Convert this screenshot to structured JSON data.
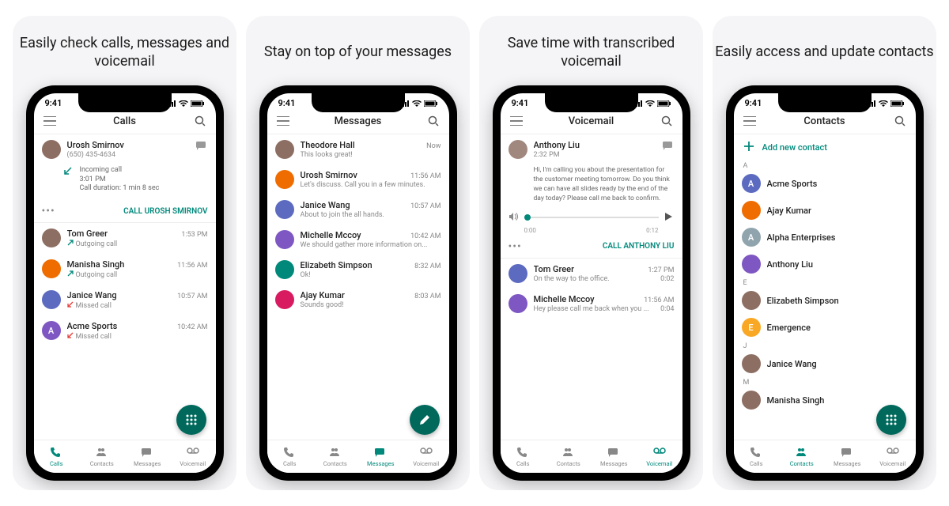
{
  "status_time": "9:41",
  "cards": [
    {
      "title": "Easily check calls, messages and voicemail"
    },
    {
      "title": "Stay on top of your messages"
    },
    {
      "title": "Save time with transcribed voicemail"
    },
    {
      "title": "Easily access and update contacts"
    }
  ],
  "nav": {
    "calls": "Calls",
    "contacts": "Contacts",
    "messages": "Messages",
    "voicemail": "Voicemail"
  },
  "calls": {
    "header": "Calls",
    "selected": {
      "name": "Urosh Smirnov",
      "phone": "(650) 435-4634",
      "status": "Incoming call",
      "time": "3:01 PM",
      "duration": "Call duration: 1 min 8 sec",
      "action": "CALL UROSH SMIRNOV"
    },
    "items": [
      {
        "name": "Tom Greer",
        "sub": "Outgoing call",
        "time": "1:53 PM",
        "dir": "out"
      },
      {
        "name": "Manisha Singh",
        "sub": "Outgoing call",
        "time": "11:56 AM",
        "dir": "out"
      },
      {
        "name": "Janice Wang",
        "sub": "Missed call",
        "time": "10:57 AM",
        "dir": "missed"
      },
      {
        "name": "Acme Sports",
        "sub": "Missed call",
        "time": "10:42 AM",
        "dir": "missed",
        "letter": "A",
        "bg": "#7e57c2"
      }
    ]
  },
  "messages": {
    "header": "Messages",
    "items": [
      {
        "name": "Theodore Hall",
        "sub": "This looks great!",
        "time": "Now"
      },
      {
        "name": "Urosh Smirnov",
        "sub": "Let's discuss. Call you in a few minutes.",
        "time": "11:56 AM"
      },
      {
        "name": "Janice Wang",
        "sub": "About to join the all hands.",
        "time": "10:57 AM"
      },
      {
        "name": "Michelle Mccoy",
        "sub": "We should gather more information on...",
        "time": "10:42 AM"
      },
      {
        "name": "Elizabeth Simpson",
        "sub": "Ok!",
        "time": "8:32 AM"
      },
      {
        "name": "Ajay Kumar",
        "sub": "Sounds good!",
        "time": "8:03 AM"
      }
    ]
  },
  "voicemail": {
    "header": "Voicemail",
    "selected": {
      "name": "Anthony Liu",
      "time": "2:32 PM",
      "transcript": "Hi, I'm calling you about the presentation for the customer meeting tomorrow. Do you think we can have all slides ready by the end of the day today? Please call me back to confirm.",
      "pos": "0:00",
      "dur": "0:12",
      "action": "CALL ANTHONY LIU"
    },
    "items": [
      {
        "name": "Tom Greer",
        "sub": "On the way to the office.",
        "time": "1:27 PM",
        "dur": "0:02"
      },
      {
        "name": "Michelle Mccoy",
        "sub": "Hey please call me back when you ...",
        "time": "11:56 AM",
        "dur": "0:04"
      }
    ]
  },
  "contacts": {
    "header": "Contacts",
    "add": "Add new contact",
    "sections": [
      {
        "letter": "A",
        "items": [
          {
            "name": "Acme Sports",
            "letter": "A",
            "bg": "#5c6bc0"
          },
          {
            "name": "Ajay Kumar"
          },
          {
            "name": "Alpha Enterprises",
            "letter": "A",
            "bg": "#90a4ae"
          },
          {
            "name": "Anthony Liu"
          }
        ]
      },
      {
        "letter": "E",
        "items": [
          {
            "name": "Elizabeth Simpson"
          },
          {
            "name": "Emergence",
            "letter": "E",
            "bg": "#f9a825"
          }
        ]
      },
      {
        "letter": "J",
        "items": [
          {
            "name": "Janice Wang"
          }
        ]
      },
      {
        "letter": "M",
        "items": [
          {
            "name": "Manisha Singh"
          }
        ]
      }
    ]
  }
}
